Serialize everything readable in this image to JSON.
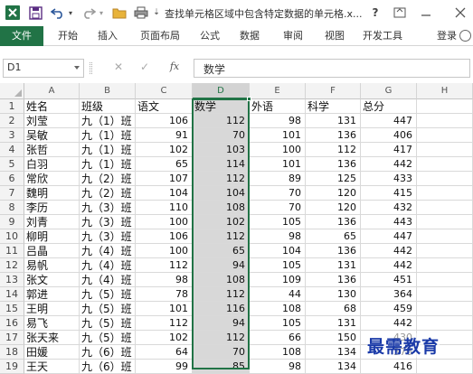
{
  "window": {
    "title": "查找单元格区域中包含特定数据的单元格.x...",
    "help": "?",
    "icons": [
      "excel-logo-icon",
      "save-icon",
      "undo-icon",
      "redo-icon",
      "open-folder-icon",
      "print-icon",
      "customize-icon",
      "help-icon",
      "ribbon-display-icon",
      "minimize-icon",
      "close-icon"
    ]
  },
  "ribbon": {
    "tabs": [
      "文件",
      "开始",
      "插入",
      "页面布局",
      "公式",
      "数据",
      "审阅",
      "视图",
      "开发工具"
    ],
    "user": "登录"
  },
  "formula_bar": {
    "name_box": "D1",
    "fx": "fx",
    "value": "数学"
  },
  "columns": [
    "A",
    "B",
    "C",
    "D",
    "E",
    "F",
    "G",
    "H"
  ],
  "rows": [
    {
      "n": "1",
      "cells": [
        "姓名",
        "班级",
        "语文",
        "数学",
        "外语",
        "科学",
        "总分",
        ""
      ]
    },
    {
      "n": "2",
      "cells": [
        "刘莹",
        "九（1）班",
        "106",
        "112",
        "98",
        "131",
        "447",
        ""
      ]
    },
    {
      "n": "3",
      "cells": [
        "吴敏",
        "九（1）班",
        "91",
        "70",
        "101",
        "136",
        "406",
        ""
      ]
    },
    {
      "n": "4",
      "cells": [
        "张哲",
        "九（1）班",
        "102",
        "103",
        "100",
        "112",
        "417",
        ""
      ]
    },
    {
      "n": "5",
      "cells": [
        "白羽",
        "九（1）班",
        "65",
        "114",
        "101",
        "136",
        "442",
        ""
      ]
    },
    {
      "n": "6",
      "cells": [
        "常欣",
        "九（2）班",
        "107",
        "112",
        "89",
        "125",
        "433",
        ""
      ]
    },
    {
      "n": "7",
      "cells": [
        "魏明",
        "九（2）班",
        "104",
        "104",
        "70",
        "120",
        "415",
        ""
      ]
    },
    {
      "n": "8",
      "cells": [
        "李历",
        "九（3）班",
        "110",
        "108",
        "70",
        "120",
        "432",
        ""
      ]
    },
    {
      "n": "9",
      "cells": [
        "刘青",
        "九（3）班",
        "100",
        "102",
        "105",
        "136",
        "443",
        ""
      ]
    },
    {
      "n": "10",
      "cells": [
        "柳明",
        "九（3）班",
        "106",
        "112",
        "98",
        "65",
        "447",
        ""
      ]
    },
    {
      "n": "11",
      "cells": [
        "吕晶",
        "九（4）班",
        "100",
        "65",
        "104",
        "136",
        "442",
        ""
      ]
    },
    {
      "n": "12",
      "cells": [
        "易帆",
        "九（4）班",
        "112",
        "94",
        "105",
        "131",
        "442",
        ""
      ]
    },
    {
      "n": "13",
      "cells": [
        "张文",
        "九（4）班",
        "98",
        "108",
        "109",
        "136",
        "451",
        ""
      ]
    },
    {
      "n": "14",
      "cells": [
        "郭进",
        "九（5）班",
        "78",
        "112",
        "44",
        "130",
        "364",
        ""
      ]
    },
    {
      "n": "15",
      "cells": [
        "王明",
        "九（5）班",
        "101",
        "116",
        "108",
        "68",
        "459",
        ""
      ]
    },
    {
      "n": "16",
      "cells": [
        "易飞",
        "九（5）班",
        "112",
        "94",
        "105",
        "131",
        "442",
        ""
      ]
    },
    {
      "n": "17",
      "cells": [
        "张天来",
        "九（5）班",
        "102",
        "112",
        "66",
        "150",
        "430",
        ""
      ]
    },
    {
      "n": "18",
      "cells": [
        "田媛",
        "九（6）班",
        "64",
        "70",
        "108",
        "134",
        "376",
        ""
      ]
    },
    {
      "n": "19",
      "cells": [
        "王天",
        "九（6）班",
        "99",
        "85",
        "98",
        "134",
        "416",
        ""
      ]
    }
  ],
  "selection": {
    "column": "D",
    "active_cell": "D1"
  },
  "watermark": "最需教育"
}
